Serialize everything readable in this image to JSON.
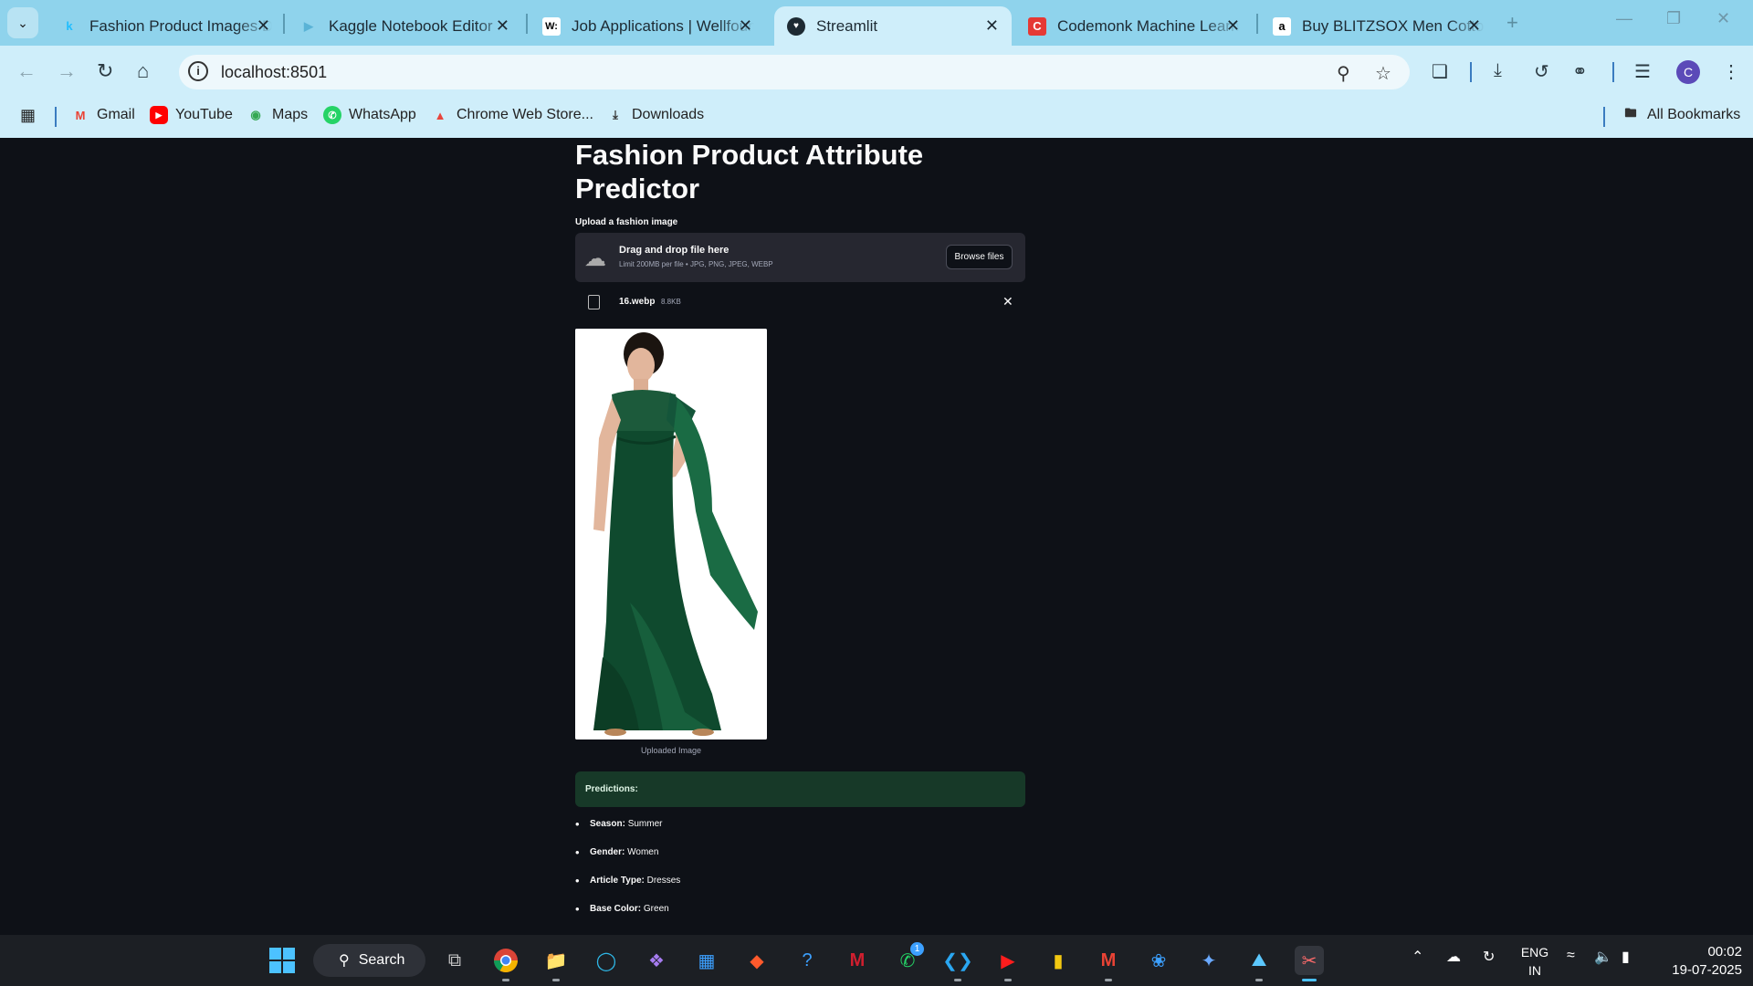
{
  "browser": {
    "tabs": [
      {
        "title": "Fashion Product Images Dataset",
        "icon": "kaggle-icon",
        "active": false
      },
      {
        "title": "Kaggle Notebook Editor",
        "icon": "kaggle-play-icon",
        "active": false
      },
      {
        "title": "Job Applications | Wellfound",
        "icon": "wellfound-icon",
        "active": false
      },
      {
        "title": "Streamlit",
        "icon": "streamlit-icon",
        "active": true
      },
      {
        "title": "Codemonk Machine Learning",
        "icon": "codemonk-icon",
        "active": false
      },
      {
        "title": "Buy BLITZSOX Men Cotton",
        "icon": "amazon-icon",
        "active": false
      }
    ],
    "url": "localhost:8501",
    "profile_initial": "C",
    "bookmarks": [
      {
        "label": "Gmail",
        "icon": "gmail-icon"
      },
      {
        "label": "YouTube",
        "icon": "youtube-icon"
      },
      {
        "label": "Maps",
        "icon": "maps-icon"
      },
      {
        "label": "WhatsApp",
        "icon": "whatsapp-icon"
      },
      {
        "label": "Chrome Web Store...",
        "icon": "chrome-web-store-icon"
      },
      {
        "label": "Downloads",
        "icon": "download-icon"
      }
    ],
    "all_bookmarks": "All Bookmarks"
  },
  "app": {
    "title": "Fashion Product Attribute Predictor",
    "upload_label": "Upload a fashion image",
    "dropzone_title": "Drag and drop file here",
    "dropzone_sub": "Limit 200MB per file • JPG, PNG, JPEG, WEBP",
    "browse_label": "Browse files",
    "file_name": "16.webp",
    "file_size": "8.8KB",
    "image_caption": "Uploaded Image",
    "predictions_heading": "Predictions:",
    "predictions": [
      {
        "key": "Season:",
        "value": "Summer"
      },
      {
        "key": "Gender:",
        "value": "Women"
      },
      {
        "key": "Article Type:",
        "value": "Dresses"
      },
      {
        "key": "Base Color:",
        "value": "Green"
      }
    ]
  },
  "taskbar": {
    "search_label": "Search",
    "whatsapp_badge": "1",
    "lang_top": "ENG",
    "lang_bottom": "IN",
    "time": "00:02",
    "date": "19-07-2025"
  }
}
